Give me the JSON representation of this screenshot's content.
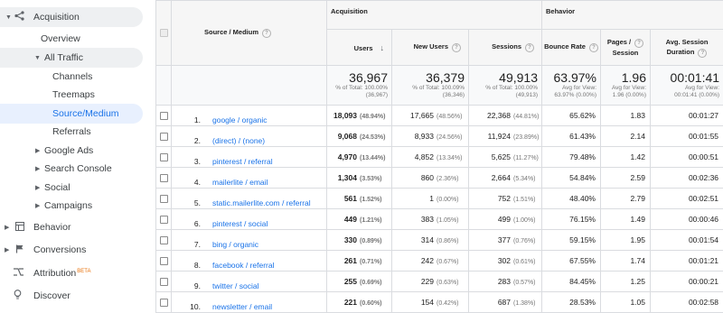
{
  "nav": {
    "acquisition": "Acquisition",
    "overview": "Overview",
    "all_traffic": "All Traffic",
    "channels": "Channels",
    "treemaps": "Treemaps",
    "source_medium": "Source/Medium",
    "referrals": "Referrals",
    "google_ads": "Google Ads",
    "search_console": "Search Console",
    "social": "Social",
    "campaigns": "Campaigns",
    "behavior": "Behavior",
    "conversions": "Conversions",
    "attribution": "Attribution",
    "attribution_badge": "BETA",
    "discover": "Discover"
  },
  "table": {
    "group_acquisition": "Acquisition",
    "group_behavior": "Behavior",
    "col_source": "Source / Medium",
    "col_users": "Users",
    "col_new_users": "New Users",
    "col_sessions": "Sessions",
    "col_bounce_rate": "Bounce Rate",
    "col_pages_line1": "Pages /",
    "col_pages_line2": "Session",
    "col_duration_line1": "Avg. Session",
    "col_duration_line2": "Duration",
    "totals": {
      "users": "36,967",
      "users_sub1": "% of Total: 100.00%",
      "users_sub2": "(36,967)",
      "new_users": "36,379",
      "new_users_sub1": "% of Total: 100.09%",
      "new_users_sub2": "(36,346)",
      "sessions": "49,913",
      "sessions_sub1": "% of Total: 100.00%",
      "sessions_sub2": "(49,913)",
      "bounce": "63.97%",
      "bounce_sub1": "Avg for View:",
      "bounce_sub2": "63.97% (0.00%)",
      "pages": "1.96",
      "pages_sub1": "Avg for View:",
      "pages_sub2": "1.96 (0.00%)",
      "duration": "00:01:41",
      "duration_sub1": "Avg for View:",
      "duration_sub2": "00:01:41 (0.00%)"
    },
    "rows": [
      {
        "idx": "1.",
        "source": "google / organic",
        "users": "18,093",
        "users_pct": "(48.94%)",
        "new_users": "17,665",
        "new_users_pct": "(48.56%)",
        "sessions": "22,368",
        "sessions_pct": "(44.81%)",
        "bounce": "65.62%",
        "pages": "1.83",
        "duration": "00:01:27"
      },
      {
        "idx": "2.",
        "source": "(direct) / (none)",
        "users": "9,068",
        "users_pct": "(24.53%)",
        "new_users": "8,933",
        "new_users_pct": "(24.56%)",
        "sessions": "11,924",
        "sessions_pct": "(23.89%)",
        "bounce": "61.43%",
        "pages": "2.14",
        "duration": "00:01:55"
      },
      {
        "idx": "3.",
        "source": "pinterest / referral",
        "users": "4,970",
        "users_pct": "(13.44%)",
        "new_users": "4,852",
        "new_users_pct": "(13.34%)",
        "sessions": "5,625",
        "sessions_pct": "(11.27%)",
        "bounce": "79.48%",
        "pages": "1.42",
        "duration": "00:00:51"
      },
      {
        "idx": "4.",
        "source": "mailerlite / email",
        "users": "1,304",
        "users_pct": "(3.53%)",
        "new_users": "860",
        "new_users_pct": "(2.36%)",
        "sessions": "2,664",
        "sessions_pct": "(5.34%)",
        "bounce": "54.84%",
        "pages": "2.59",
        "duration": "00:02:36"
      },
      {
        "idx": "5.",
        "source": "static.mailerlite.com / referral",
        "users": "561",
        "users_pct": "(1.52%)",
        "new_users": "1",
        "new_users_pct": "(0.00%)",
        "sessions": "752",
        "sessions_pct": "(1.51%)",
        "bounce": "48.40%",
        "pages": "2.79",
        "duration": "00:02:51"
      },
      {
        "idx": "6.",
        "source": "pinterest / social",
        "users": "449",
        "users_pct": "(1.21%)",
        "new_users": "383",
        "new_users_pct": "(1.05%)",
        "sessions": "499",
        "sessions_pct": "(1.00%)",
        "bounce": "76.15%",
        "pages": "1.49",
        "duration": "00:00:46"
      },
      {
        "idx": "7.",
        "source": "bing / organic",
        "users": "330",
        "users_pct": "(0.89%)",
        "new_users": "314",
        "new_users_pct": "(0.86%)",
        "sessions": "377",
        "sessions_pct": "(0.76%)",
        "bounce": "59.15%",
        "pages": "1.95",
        "duration": "00:01:54"
      },
      {
        "idx": "8.",
        "source": "facebook / referral",
        "users": "261",
        "users_pct": "(0.71%)",
        "new_users": "242",
        "new_users_pct": "(0.67%)",
        "sessions": "302",
        "sessions_pct": "(0.61%)",
        "bounce": "67.55%",
        "pages": "1.74",
        "duration": "00:01:21"
      },
      {
        "idx": "9.",
        "source": "twitter / social",
        "users": "255",
        "users_pct": "(0.69%)",
        "new_users": "229",
        "new_users_pct": "(0.63%)",
        "sessions": "283",
        "sessions_pct": "(0.57%)",
        "bounce": "84.45%",
        "pages": "1.25",
        "duration": "00:00:21"
      },
      {
        "idx": "10.",
        "source": "newsletter / email",
        "users": "221",
        "users_pct": "(0.60%)",
        "new_users": "154",
        "new_users_pct": "(0.42%)",
        "sessions": "687",
        "sessions_pct": "(1.38%)",
        "bounce": "28.53%",
        "pages": "1.05",
        "duration": "00:02:58"
      }
    ]
  }
}
